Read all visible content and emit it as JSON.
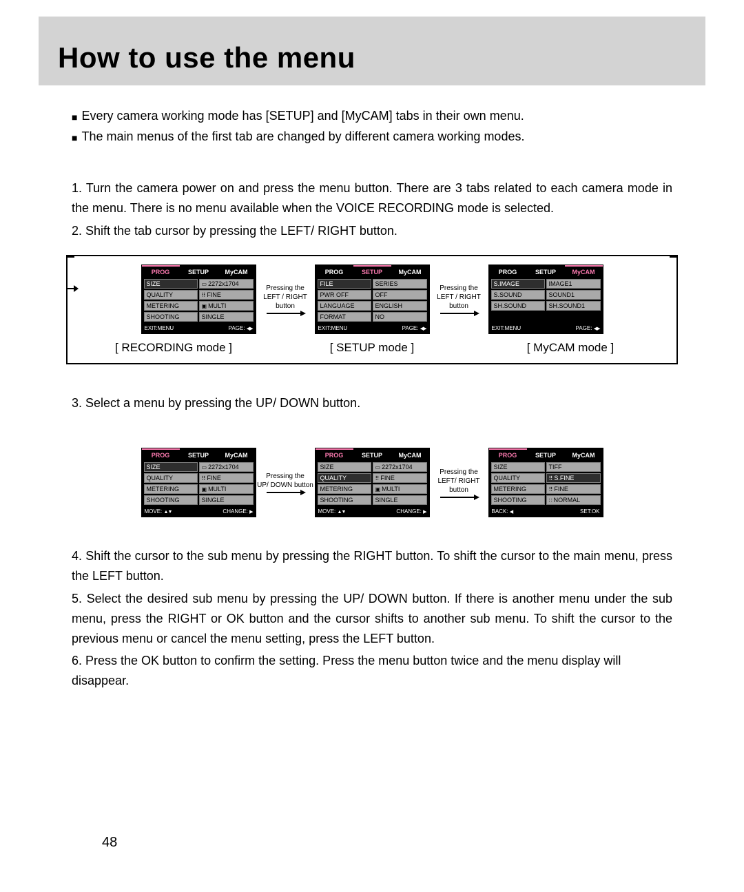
{
  "title": "How to use the menu",
  "page_number": "48",
  "bullets": [
    "Every camera working mode has [SETUP] and [MyCAM] tabs in their own menu.",
    "The main menus of the first tab are changed by different camera working modes."
  ],
  "steps_a": [
    "1. Turn the camera power on and press the menu button. There are 3 tabs related to each camera mode in the menu. There is no menu available when the VOICE RECORDING mode is selected.",
    "2. Shift the tab cursor by pressing the LEFT/ RIGHT button."
  ],
  "steps_b": [
    "3. Select a menu by pressing the UP/ DOWN button."
  ],
  "steps_c": [
    "4. Shift the cursor to the sub menu by pressing the RIGHT button. To shift the cursor to the main menu, press the LEFT button.",
    "5. Select the desired sub menu by pressing the UP/ DOWN button. If there is another menu under the sub menu, press the RIGHT or OK button and the cursor shifts to another sub menu. To shift the cursor to the previous menu or cancel the menu setting, press the LEFT button.",
    "6. Press the OK button to confirm the setting.\n    Press the menu button twice and the menu display will disappear."
  ],
  "fig1": {
    "arrow1": {
      "a": "Pressing the",
      "b": "LEFT / RIGHT button"
    },
    "arrow2": {
      "a": "Pressing the",
      "b": "LEFT / RIGHT button"
    },
    "captions": [
      "[ RECORDING mode ]",
      "[ SETUP mode ]",
      "[ MyCAM mode ]"
    ],
    "screens": [
      {
        "tabs": [
          "PROG",
          "SETUP",
          "MyCAM"
        ],
        "rows": [
          {
            "l": "SIZE",
            "r": "2272x1704"
          },
          {
            "l": "QUALITY",
            "r": "FINE"
          },
          {
            "l": "METERING",
            "r": "MULTI"
          },
          {
            "l": "SHOOTING",
            "r": "SINGLE"
          }
        ],
        "footer": {
          "l": "EXIT:MENU",
          "r": "PAGE:"
        }
      },
      {
        "tabs": [
          "PROG",
          "SETUP",
          "MyCAM"
        ],
        "rows": [
          {
            "l": "FILE",
            "r": "SERIES"
          },
          {
            "l": "PWR OFF",
            "r": "OFF"
          },
          {
            "l": "LANGUAGE",
            "r": "ENGLISH"
          },
          {
            "l": "FORMAT",
            "r": "NO"
          }
        ],
        "footer": {
          "l": "EXIT:MENU",
          "r": "PAGE:"
        }
      },
      {
        "tabs": [
          "PROG",
          "SETUP",
          "MyCAM"
        ],
        "rows": [
          {
            "l": "S.IMAGE",
            "r": "IMAGE1"
          },
          {
            "l": "S.SOUND",
            "r": "SOUND1"
          },
          {
            "l": "SH.SOUND",
            "r": "SH.SOUND1"
          }
        ],
        "footer": {
          "l": "EXIT:MENU",
          "r": "PAGE:"
        }
      }
    ]
  },
  "fig2": {
    "arrow1": {
      "a": "Pressing the",
      "b": "UP/ DOWN button"
    },
    "arrow2": {
      "a": "Pressing the",
      "b": "LEFT/ RIGHT button"
    },
    "screens": [
      {
        "tabs": [
          "PROG",
          "SETUP",
          "MyCAM"
        ],
        "rows": [
          {
            "l": "SIZE",
            "r": "2272x1704"
          },
          {
            "l": "QUALITY",
            "r": "FINE"
          },
          {
            "l": "METERING",
            "r": "MULTI"
          },
          {
            "l": "SHOOTING",
            "r": "SINGLE"
          }
        ],
        "footer": {
          "l": "MOVE:",
          "r": "CHANGE:"
        }
      },
      {
        "tabs": [
          "PROG",
          "SETUP",
          "MyCAM"
        ],
        "rows": [
          {
            "l": "SIZE",
            "r": "2272x1704"
          },
          {
            "l": "QUALITY",
            "r": "FINE"
          },
          {
            "l": "METERING",
            "r": "MULTI"
          },
          {
            "l": "SHOOTING",
            "r": "SINGLE"
          }
        ],
        "footer": {
          "l": "MOVE:",
          "r": "CHANGE:"
        }
      },
      {
        "tabs": [
          "PROG",
          "SETUP",
          "MyCAM"
        ],
        "rows": [
          {
            "l": "SIZE",
            "r": "TIFF"
          },
          {
            "l": "QUALITY",
            "r": "S.FINE"
          },
          {
            "l": "METERING",
            "r": "FINE"
          },
          {
            "l": "SHOOTING",
            "r": "NORMAL"
          }
        ],
        "footer": {
          "l": "BACK:",
          "r": "SET:OK"
        }
      }
    ]
  }
}
